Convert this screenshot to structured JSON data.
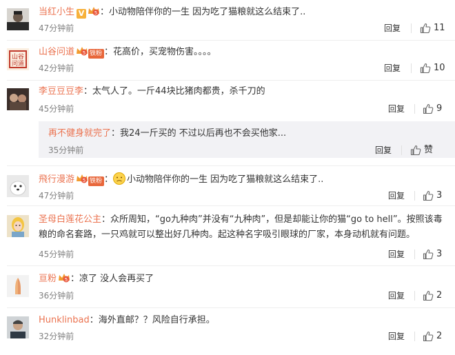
{
  "ui": {
    "reply_label": "回复",
    "like_icon": "thumbs-up-icon",
    "colors": {
      "username": "#eb7350",
      "text": "#333333",
      "meta": "#808080",
      "subbox_bg": "#f2f2f5"
    }
  },
  "comments": [
    {
      "username": "当红小生",
      "badges": [
        "v-verified",
        "vip-level-5"
      ],
      "text": "小动物陪伴你的一生 因为吃了猫粮就这么结束了..",
      "time": "47分钟前",
      "likes": "11"
    },
    {
      "username": "山谷问道",
      "badges": [
        "crown-level-5",
        "fan-badge"
      ],
      "fan_badge_text": "铁粉",
      "text": "花高价，买宠物伤害。。。。",
      "time": "42分钟前",
      "likes": "10"
    },
    {
      "username": "李豆豆豆李",
      "badges": [],
      "text": "太气人了。一斤44块比猪肉都贵，杀千刀的",
      "time": "45分钟前",
      "likes": "9",
      "reply": {
        "username": "再不健身就完了",
        "text": "我24一斤买的 不过以后再也不会买他家...",
        "time": "35分钟前",
        "likes": "赞"
      }
    },
    {
      "username": "飛行漫游",
      "badges": [
        "crown-level-5",
        "fan-badge"
      ],
      "fan_badge_text": "铁粉",
      "text": "小动物陪伴你的一生 因为吃了猫粮就这么结束了..",
      "emoji": "sad-face-emoji",
      "time": "47分钟前",
      "likes": "3"
    },
    {
      "username": "圣母白莲花公主",
      "badges": [],
      "text_line1": "众所周知，“go九种肉”并没有“九种肉”，但是却能让你的猫“go to hell”。按照该毒",
      "text_line2": "粮的命名套路，一只鸡就可以整出好几种肉。起这种名字吸引眼球的厂家，本身动机就有问题。",
      "time": "45分钟前",
      "likes": "3"
    },
    {
      "username": "亘粉",
      "badges": [
        "crown-level-5"
      ],
      "text": "凉了 没人会再买了",
      "time": "36分钟前",
      "likes": "2"
    },
    {
      "username": "Hunklinbad",
      "badges": [],
      "text": "海外直邮？？风险自行承担。",
      "time": "32分钟前",
      "likes": "2"
    }
  ]
}
